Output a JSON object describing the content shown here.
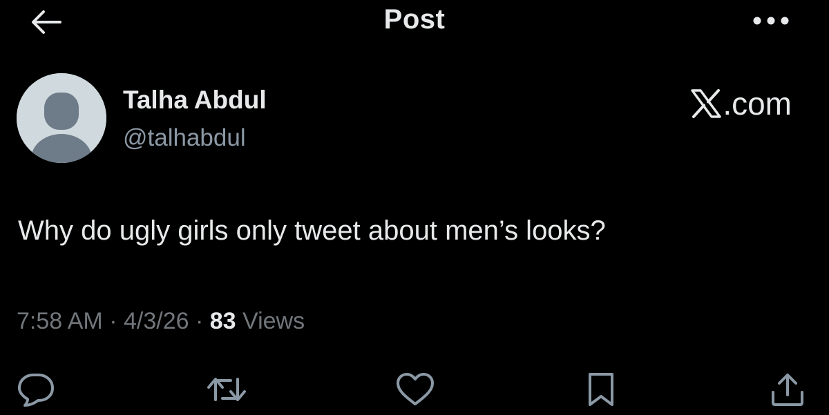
{
  "header": {
    "title": "Post",
    "back_icon": "arrow-left-icon",
    "more_icon": "more-horizontal-icon"
  },
  "post": {
    "author": {
      "name": "Talha Abdul",
      "handle": "@talhabdul",
      "avatar_icon": "default-avatar-icon"
    },
    "brand": {
      "logo_icon": "x-logo-icon",
      "suffix": ".com"
    },
    "text": "Why do ugly girls only tweet about men’s looks?",
    "time": "7:58 AM",
    "date": "4/3/26",
    "separator": "·",
    "views_count": "83",
    "views_label": "Views"
  },
  "actions": [
    {
      "icon": "reply-icon"
    },
    {
      "icon": "repost-icon"
    },
    {
      "icon": "like-icon"
    },
    {
      "icon": "bookmark-icon"
    },
    {
      "icon": "share-icon"
    }
  ],
  "colors": {
    "background": "#000000",
    "primary_text": "#e7e9ea",
    "secondary_text": "#71767b",
    "handle_text": "#8b98a5",
    "avatar_bg": "#cfd9de",
    "avatar_fg": "#6e7b88"
  }
}
